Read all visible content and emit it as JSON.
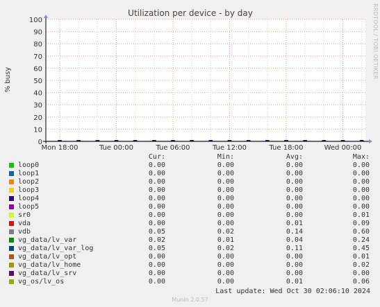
{
  "chart_data": {
    "type": "line",
    "title": "Utilization per device - by day",
    "ylabel": "% busy",
    "xlabel": "",
    "ylim": [
      0,
      100
    ],
    "y_ticks": [
      "0",
      "10",
      "20",
      "30",
      "40",
      "50",
      "60",
      "70",
      "80",
      "90",
      "100"
    ],
    "x_ticks": [
      "Mon 18:00",
      "Tue 00:00",
      "Tue 06:00",
      "Tue 12:00",
      "Tue 18:00",
      "Wed 00:00"
    ],
    "grid": true,
    "series_colors": [
      "#00cc00",
      "#0066b3",
      "#ff8000",
      "#ffcc00",
      "#330099",
      "#990099",
      "#ccff00",
      "#ff0000",
      "#808080",
      "#008f00",
      "#00487d",
      "#b35a00",
      "#b38f00",
      "#6b006b",
      "#8fb300"
    ],
    "legend_header": {
      "cur": "Cur:",
      "min": "Min:",
      "avg": "Avg:",
      "max": "Max:"
    },
    "series": [
      {
        "name": "loop0",
        "cur": "0.00",
        "min": "0.00",
        "avg": "0.00",
        "max": "0.00"
      },
      {
        "name": "loop1",
        "cur": "0.00",
        "min": "0.00",
        "avg": "0.00",
        "max": "0.00"
      },
      {
        "name": "loop2",
        "cur": "0.00",
        "min": "0.00",
        "avg": "0.00",
        "max": "0.00"
      },
      {
        "name": "loop3",
        "cur": "0.00",
        "min": "0.00",
        "avg": "0.00",
        "max": "0.00"
      },
      {
        "name": "loop4",
        "cur": "0.00",
        "min": "0.00",
        "avg": "0.00",
        "max": "0.00"
      },
      {
        "name": "loop5",
        "cur": "0.00",
        "min": "0.00",
        "avg": "0.00",
        "max": "0.00"
      },
      {
        "name": "sr0",
        "cur": "0.00",
        "min": "0.00",
        "avg": "0.00",
        "max": "0.01"
      },
      {
        "name": "vda",
        "cur": "0.00",
        "min": "0.00",
        "avg": "0.01",
        "max": "0.09"
      },
      {
        "name": "vdb",
        "cur": "0.05",
        "min": "0.02",
        "avg": "0.14",
        "max": "0.60"
      },
      {
        "name": "vg_data/lv_var",
        "cur": "0.02",
        "min": "0.01",
        "avg": "0.04",
        "max": "0.24"
      },
      {
        "name": "vg_data/lv_var_log",
        "cur": "0.05",
        "min": "0.02",
        "avg": "0.11",
        "max": "0.45"
      },
      {
        "name": "vg_data/lv_opt",
        "cur": "0.00",
        "min": "0.00",
        "avg": "0.00",
        "max": "0.01"
      },
      {
        "name": "vg_data/lv_home",
        "cur": "0.00",
        "min": "0.00",
        "avg": "0.00",
        "max": "0.02"
      },
      {
        "name": "vg_data/lv_srv",
        "cur": "0.00",
        "min": "0.00",
        "avg": "0.00",
        "max": "0.00"
      },
      {
        "name": "vg_os/lv_os",
        "cur": "0.00",
        "min": "0.00",
        "avg": "0.01",
        "max": "0.06"
      }
    ]
  },
  "side_note": "RRDTOOL / TOBI OETIKER",
  "last_update": "Last update: Wed Oct 30 02:06:10 2024",
  "footer": "Munin 2.0.57"
}
